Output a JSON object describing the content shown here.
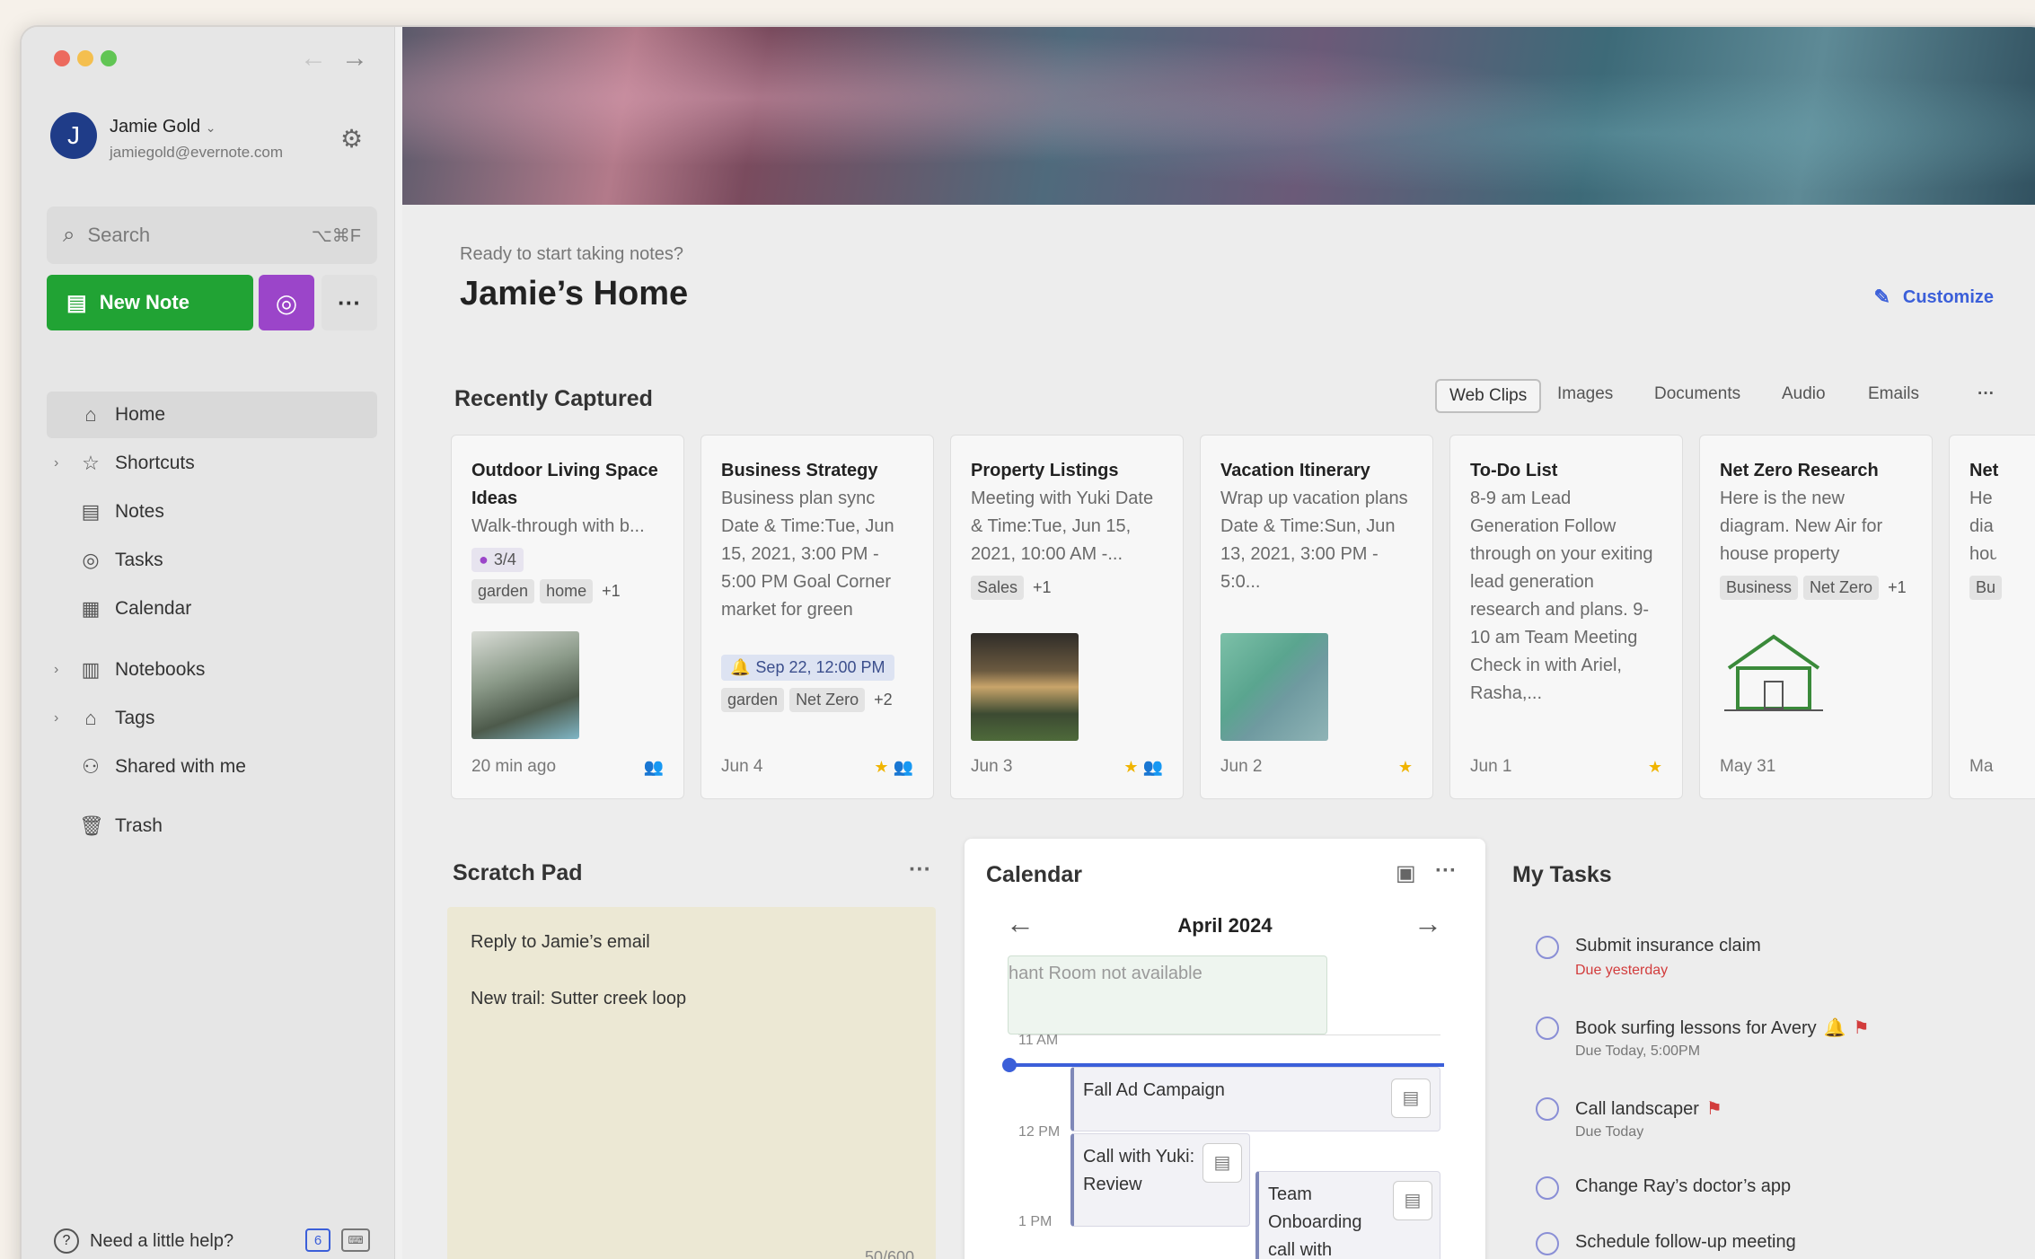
{
  "account": {
    "initial": "J",
    "name": "Jamie Gold",
    "email": "jamiegold@evernote.com"
  },
  "search": {
    "label": "Search",
    "shortcut": "⌥⌘F"
  },
  "new_note": {
    "label": "New Note"
  },
  "nav": [
    {
      "label": "Home"
    },
    {
      "label": "Shortcuts"
    },
    {
      "label": "Notes"
    },
    {
      "label": "Tasks"
    },
    {
      "label": "Calendar"
    },
    {
      "label": "Notebooks"
    },
    {
      "label": "Tags"
    },
    {
      "label": "Shared with me"
    },
    {
      "label": "Trash"
    }
  ],
  "help": {
    "label": "Need a little help?",
    "badge": "6"
  },
  "header": {
    "subtitle": "Ready to start taking notes?",
    "title": "Jamie’s Home",
    "customize": "Customize"
  },
  "recent": {
    "title": "Recently Captured",
    "filters": [
      "Web Clips",
      "Images",
      "Documents",
      "Audio",
      "Emails"
    ],
    "cards": [
      {
        "title": "Outdoor Living Space Ideas",
        "body": "Walk-through with b...",
        "task": "3/4",
        "tags": [
          "garden",
          "home"
        ],
        "more": "+1",
        "date": "20 min ago"
      },
      {
        "title": "Business Strategy",
        "body": "Business plan sync Date & Time:Tue, Jun 15, 2021, 3:00 PM - 5:00 PM Goal Corner market for green",
        "reminder": "Sep 22, 12:00 PM",
        "tags": [
          "garden",
          "Net Zero"
        ],
        "more": "+2",
        "date": "Jun 4"
      },
      {
        "title": "Property Listings",
        "body": "Meeting with Yuki Date & Time:Tue, Jun 15, 2021, 10:00 AM -...",
        "tags": [
          "Sales"
        ],
        "more": "+1",
        "date": "Jun 3"
      },
      {
        "title": "Vacation Itinerary",
        "body": "Wrap up vacation plans Date & Time:Sun, Jun 13, 2021, 3:00 PM - 5:0...",
        "date": "Jun 2"
      },
      {
        "title": "To-Do List",
        "body": "8-9 am Lead Generation Follow through on your exiting lead generation research and plans. 9-10 am Team Meeting Check in with Ariel, Rasha,...",
        "date": "Jun 1"
      },
      {
        "title": "Net Zero Research",
        "body": "Here is the new diagram. New Air for house property",
        "tags": [
          "Business",
          "Net Zero"
        ],
        "more": "+1",
        "date": "May 31"
      },
      {
        "title": "Net",
        "body": "He dia hou",
        "tags": [
          "Bu"
        ],
        "date": "Ma"
      }
    ]
  },
  "scratch": {
    "title": "Scratch Pad",
    "line1": "Reply to Jamie’s email",
    "line2": "New trail: Sutter creek loop",
    "count": "50/600"
  },
  "calendar": {
    "title": "Calendar",
    "month": "April 2024",
    "times": [
      "11 AM",
      "12 PM",
      "1 PM"
    ],
    "events": {
      "faded": "hant Room not available",
      "e1": "Fall Ad Campaign",
      "e2": "Call with Yuki: Review",
      "e3": "Team Onboarding call with"
    }
  },
  "tasks": {
    "title": "My Tasks",
    "items": [
      {
        "label": "Submit insurance claim",
        "due": "Due yesterday"
      },
      {
        "label": "Book surfing lessons for Avery",
        "due": "Due Today, 5:00PM"
      },
      {
        "label": "Call landscaper",
        "due": "Due Today"
      },
      {
        "label": "Change Ray’s doctor’s app"
      },
      {
        "label": "Schedule follow-up meeting"
      }
    ]
  },
  "icons": {
    "search": "magnifier-icon",
    "settings": "gear-icon",
    "customize": "pencil-icon"
  },
  "colors": {
    "new_note": "#21a334",
    "task_button": "#9b45c9",
    "link": "#3b5fd9",
    "overdue": "#d23c3c",
    "star": "#f0b400"
  }
}
